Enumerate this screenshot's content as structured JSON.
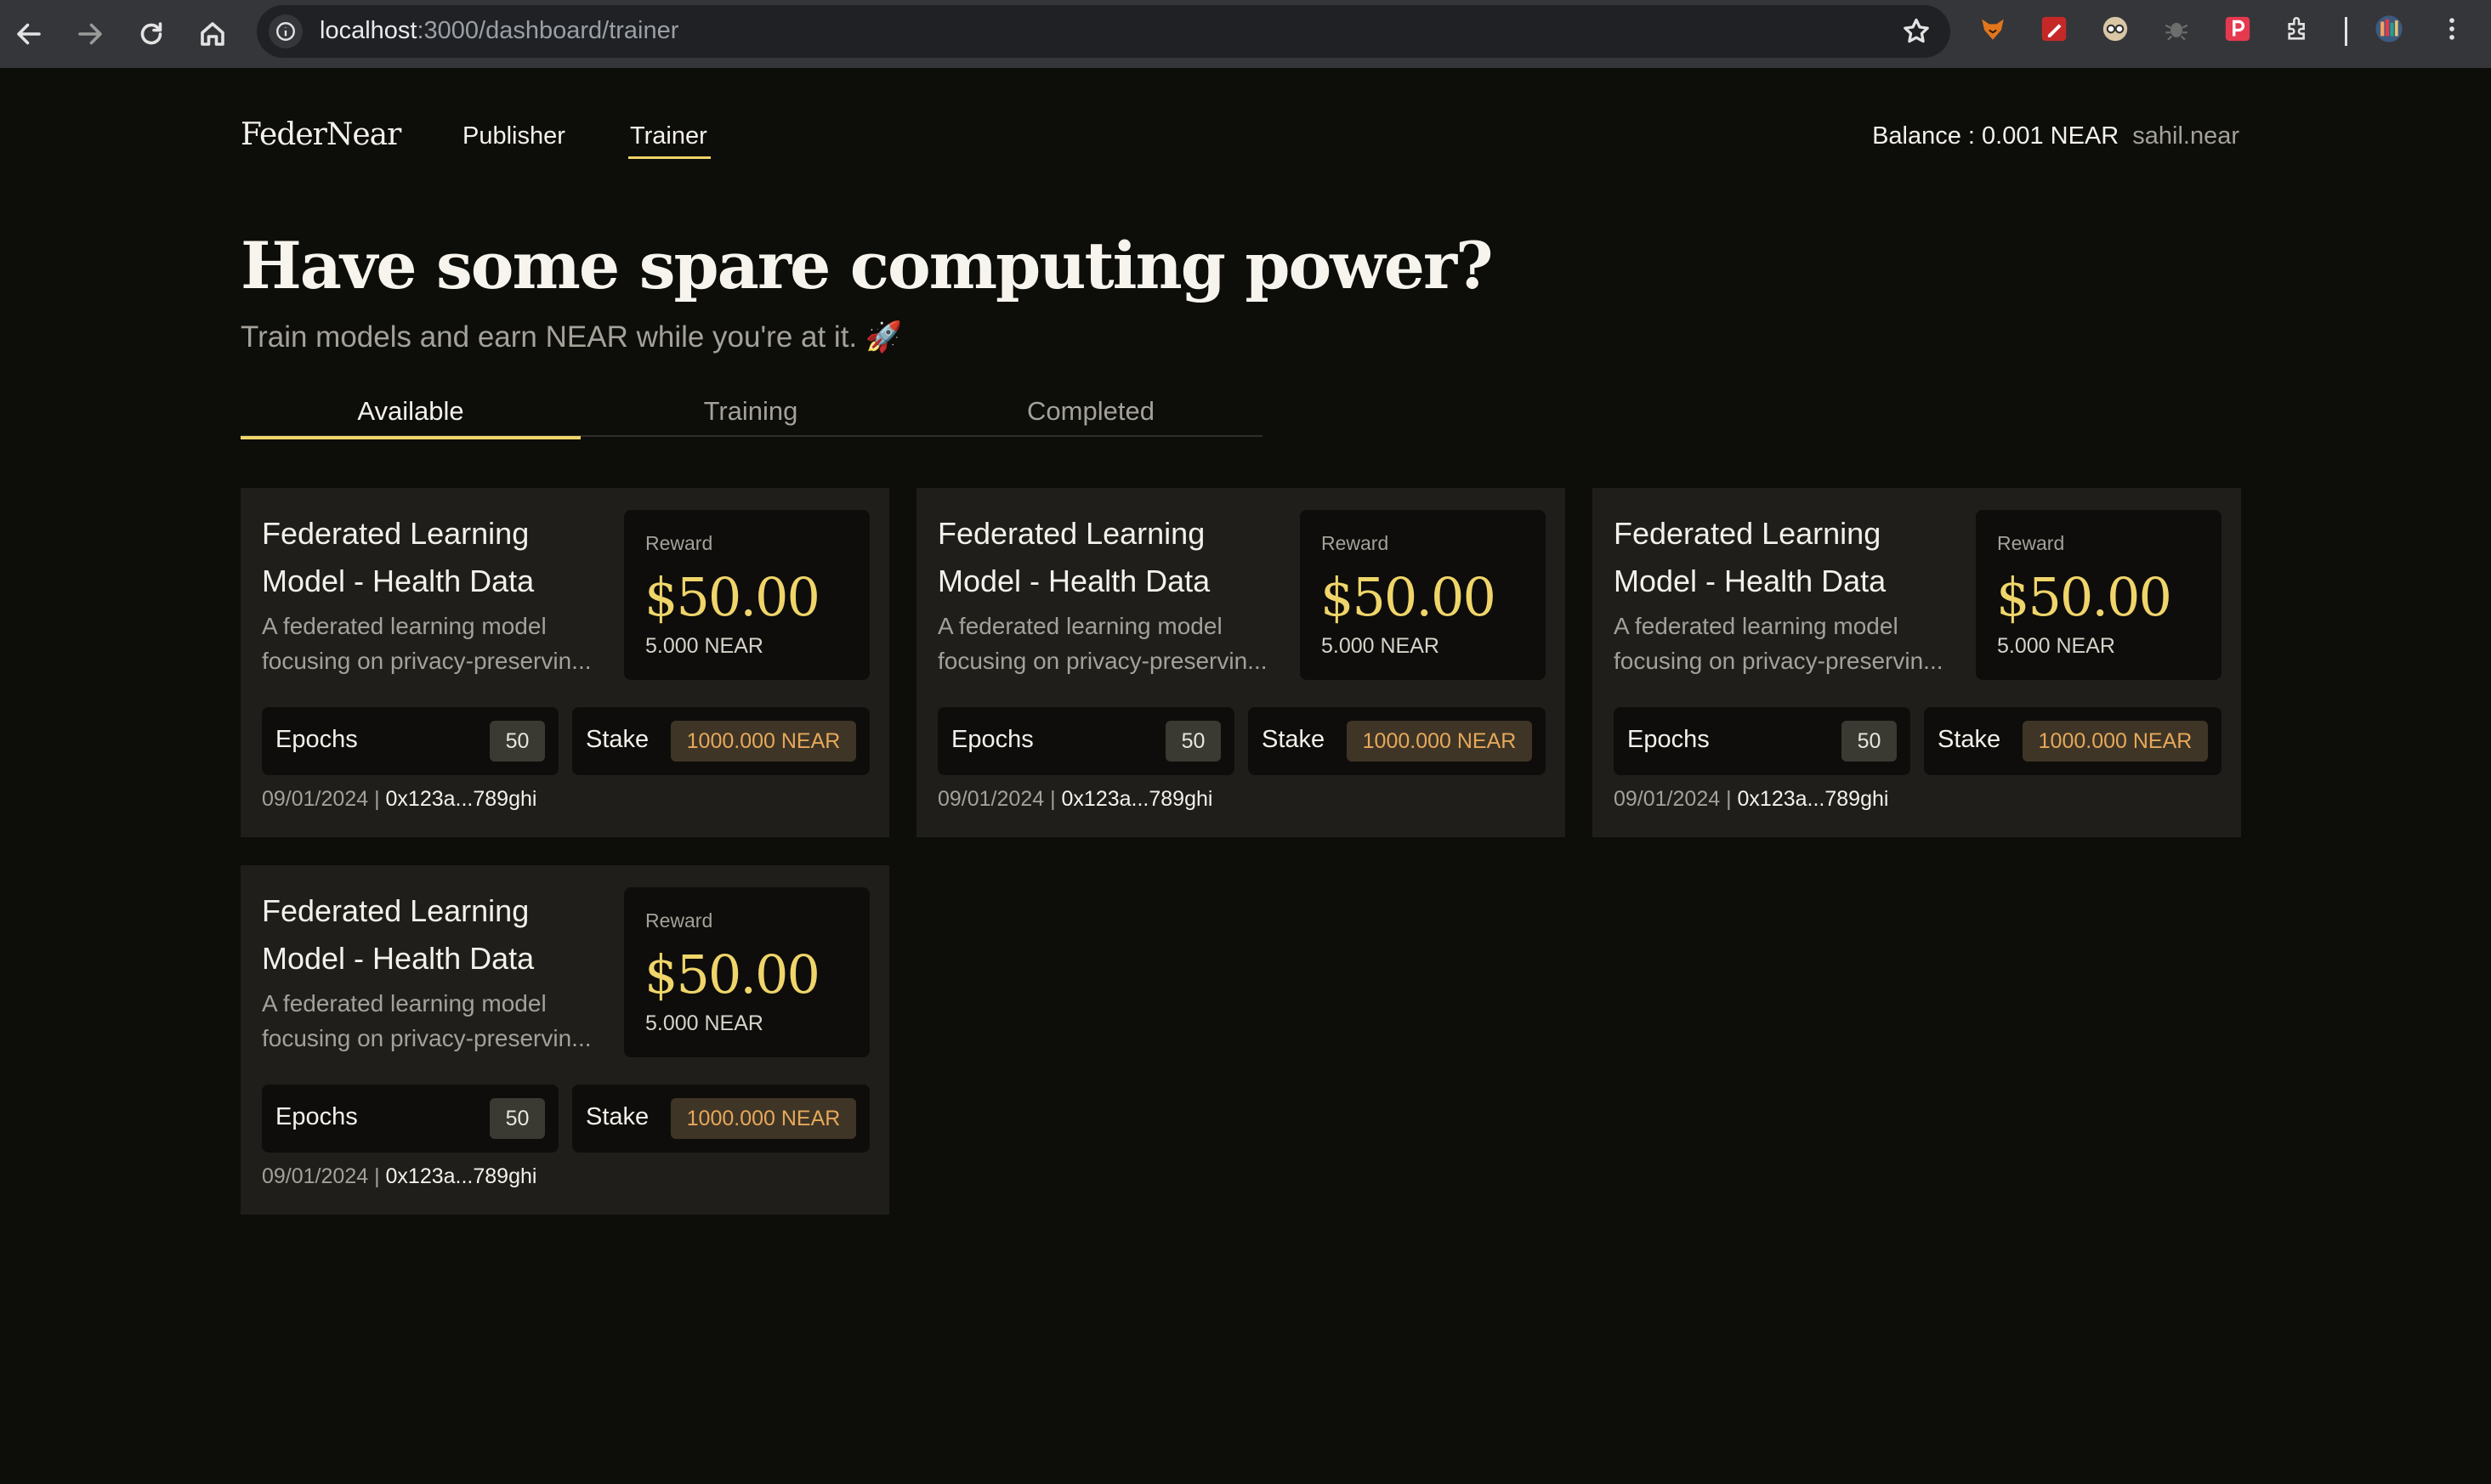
{
  "browser": {
    "url_host": "localhost",
    "url_path": ":3000/dashboard/trainer",
    "extensions": [
      "fox-extension-icon",
      "red-pen-extension-icon",
      "glasses-extension-icon",
      "bug-extension-icon",
      "red-p-extension-icon",
      "puzzle-extensions-icon",
      "profile-avatar-icon",
      "kebab-menu-icon"
    ]
  },
  "header": {
    "brand": "FederNear",
    "nav": [
      {
        "label": "Publisher",
        "active": false
      },
      {
        "label": "Trainer",
        "active": true
      }
    ],
    "balance": "Balance : 0.001 NEAR",
    "account": "sahil.near"
  },
  "hero": {
    "title": "Have some spare computing power?",
    "subtitle": "Train models and earn NEAR while you're at it. 🚀"
  },
  "tabs": [
    {
      "label": "Available",
      "active": true
    },
    {
      "label": "Training",
      "active": false
    },
    {
      "label": "Completed",
      "active": false
    }
  ],
  "cards": [
    {
      "title": "Federated Learning Model - Health Data",
      "desc_line1": "A federated learning model",
      "desc_line2": "focusing on privacy-preservin...",
      "reward_label": "Reward",
      "reward_usd": "$50.00",
      "reward_near": "5.000 NEAR",
      "epochs_label": "Epochs",
      "epochs": "50",
      "stake_label": "Stake",
      "stake": "1000.000 NEAR",
      "date": "09/01/2024",
      "separator": " | ",
      "hash": "0x123a...789ghi"
    },
    {
      "title": "Federated Learning Model - Health Data",
      "desc_line1": "A federated learning model",
      "desc_line2": "focusing on privacy-preservin...",
      "reward_label": "Reward",
      "reward_usd": "$50.00",
      "reward_near": "5.000 NEAR",
      "epochs_label": "Epochs",
      "epochs": "50",
      "stake_label": "Stake",
      "stake": "1000.000 NEAR",
      "date": "09/01/2024",
      "separator": " | ",
      "hash": "0x123a...789ghi"
    },
    {
      "title": "Federated Learning Model - Health Data",
      "desc_line1": "A federated learning model",
      "desc_line2": "focusing on privacy-preservin...",
      "reward_label": "Reward",
      "reward_usd": "$50.00",
      "reward_near": "5.000 NEAR",
      "epochs_label": "Epochs",
      "epochs": "50",
      "stake_label": "Stake",
      "stake": "1000.000 NEAR",
      "date": "09/01/2024",
      "separator": " | ",
      "hash": "0x123a...789ghi"
    },
    {
      "title": "Federated Learning Model - Health Data",
      "desc_line1": "A federated learning model",
      "desc_line2": "focusing on privacy-preservin...",
      "reward_label": "Reward",
      "reward_usd": "$50.00",
      "reward_near": "5.000 NEAR",
      "epochs_label": "Epochs",
      "epochs": "50",
      "stake_label": "Stake",
      "stake": "1000.000 NEAR",
      "date": "09/01/2024",
      "separator": " | ",
      "hash": "0x123a...789ghi"
    }
  ],
  "colors": {
    "accent": "#efd56a",
    "background": "#0d0d0a",
    "card": "#1f1e1a",
    "stake_text": "#e6a85a"
  }
}
